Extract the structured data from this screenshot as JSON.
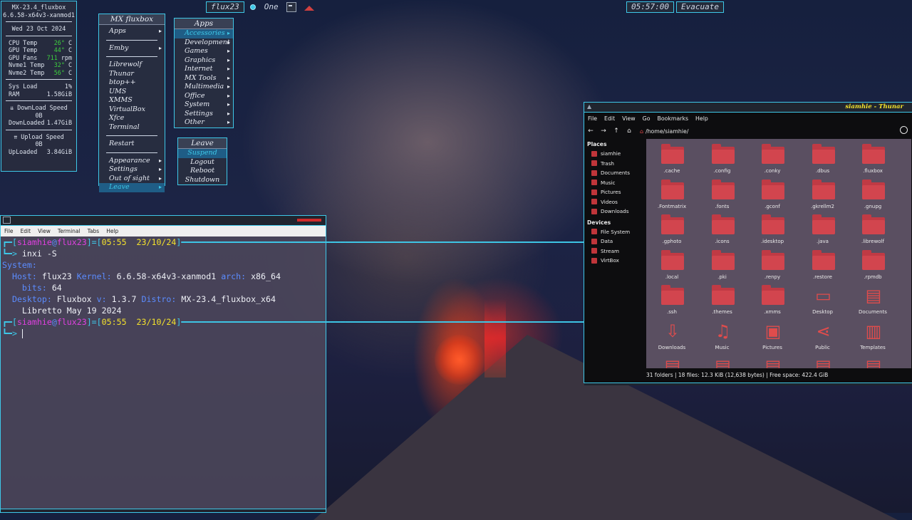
{
  "topbar": {
    "workspace_name": "flux23",
    "workspace_label": "One",
    "clock": "05:57:00",
    "exit_label": "Evacuate"
  },
  "conky": {
    "title": "MX-23.4_fluxbox",
    "kernel": "6.6.58-x64v3-xanmod1",
    "date": "Wed 23 Oct 2024",
    "cpu_temp_label": "CPU Temp",
    "cpu_temp": "26°",
    "cpu_temp_unit": "C",
    "gpu_temp_label": "GPU Temp",
    "gpu_temp": "44°",
    "gpu_temp_unit": "C",
    "gpu_fans_label": "GPU Fans",
    "gpu_fans": "711",
    "gpu_fans_unit": "rpm",
    "nvme1_label": "Nvme1 Temp",
    "nvme1": "32°",
    "nvme1_unit": "C",
    "nvme2_label": "Nvme2 Temp",
    "nvme2": "56°",
    "nvme2_unit": "C",
    "sys_load_label": "Sys Load",
    "sys_load": "1%",
    "ram_label": "RAM",
    "ram": "1.58GiB",
    "download_speed_label": "⇊ DownLoad Speed",
    "download_speed": "0B",
    "downloaded_label": "DownLoaded",
    "downloaded": "1.47GiB",
    "upload_speed_label": "⇈ Upload Speed",
    "upload_speed": "0B",
    "uploaded_label": "UpLoaded",
    "uploaded": "3.84GiB"
  },
  "root_menu": {
    "title": "MX fluxbox",
    "items": [
      "Apps",
      "Emby",
      "Librewolf",
      "Thunar",
      "btop++",
      "UMS",
      "XMMS",
      "VirtualBox",
      "Xfce Terminal",
      "Restart",
      "Appearance",
      "Settings",
      "Out of sight",
      "Leave"
    ]
  },
  "apps_menu": {
    "title": "Apps",
    "items": [
      "Accessories",
      "Development",
      "Games",
      "Graphics",
      "Internet",
      "MX Tools",
      "Multimedia",
      "Office",
      "System",
      "Settings",
      "Other"
    ]
  },
  "leave_menu": {
    "title": "Leave",
    "items": [
      "Suspend",
      "Logout",
      "Reboot",
      "Shutdown"
    ]
  },
  "terminal": {
    "menu": [
      "File",
      "Edit",
      "View",
      "Terminal",
      "Tabs",
      "Help"
    ],
    "prompt_user": "siamhie",
    "prompt_at": "@",
    "prompt_host": "flux23",
    "prompt_time": "05:55",
    "prompt_date": "23/10/24",
    "command": "inxi -S",
    "system_label": "System:",
    "host_label": "Host:",
    "host": "flux23",
    "kernel_label": "Kernel:",
    "kernel": "6.6.58-x64v3-xanmod1",
    "arch_label": "arch:",
    "arch": "x86_64",
    "bits_label": "bits:",
    "bits": "64",
    "desktop_label": "Desktop:",
    "desktop": "Fluxbox",
    "v_label": "v:",
    "version": "1.3.7",
    "distro_label": "Distro:",
    "distro": "MX-23.4_fluxbox_x64",
    "distro_line2": "Libretto May 19 2024"
  },
  "thunar": {
    "title": "siamhie - Thunar",
    "menu": [
      "File",
      "Edit",
      "View",
      "Go",
      "Bookmarks",
      "Help"
    ],
    "path": "/home/siamhie/",
    "places_header": "Places",
    "places": [
      "siamhie",
      "Trash",
      "Documents",
      "Music",
      "Pictures",
      "Videos",
      "Downloads"
    ],
    "devices_header": "Devices",
    "devices": [
      "File System",
      "Data",
      "Stream",
      "VirtBox"
    ],
    "files": [
      ".cache",
      ".config",
      ".conky",
      ".dbus",
      ".fluxbox",
      ".Fontmatrix",
      ".fonts",
      ".gconf",
      ".gkrellm2",
      ".gnupg",
      ".gphoto",
      ".icons",
      ".idesktop",
      ".java",
      ".librewolf",
      ".local",
      ".pki",
      ".renpy",
      ".restore",
      ".rpmdb",
      ".ssh",
      ".themes",
      ".xmms",
      "Desktop",
      "Documents",
      "Downloads",
      "Music",
      "Pictures",
      "Public",
      "Templates"
    ],
    "status": "31 folders  |  18 files: 12.3 KiB (12,638 bytes)  |  Free space: 422.4 GiB"
  },
  "colors": {
    "accent": "#3ec8e8",
    "folder": "#c03a44",
    "prompt_user": "#e040e0",
    "prompt_time": "#f4e22c"
  }
}
